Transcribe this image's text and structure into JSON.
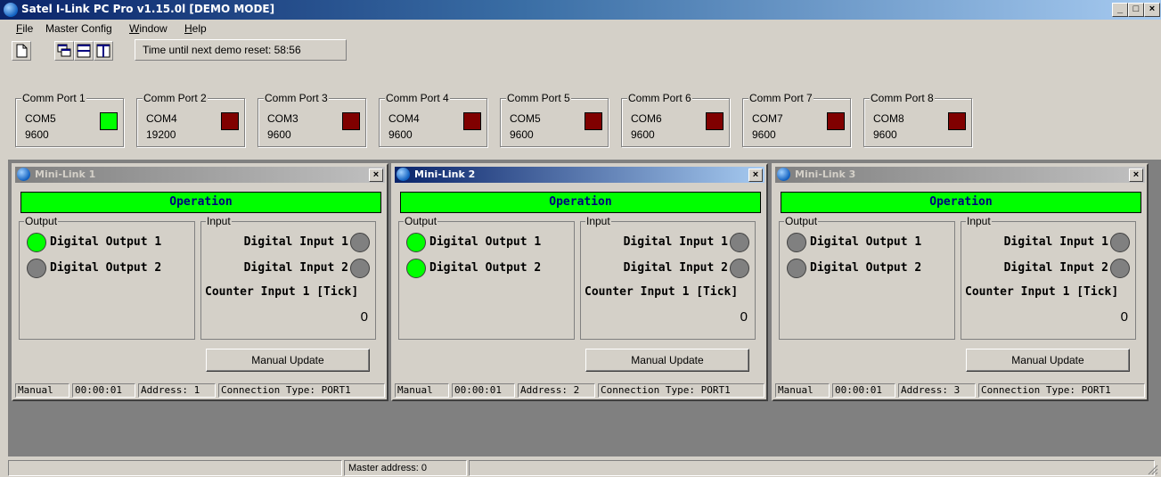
{
  "window": {
    "title": "Satel I-Link PC Pro v1.15.0l [DEMO MODE]"
  },
  "menu": {
    "items": [
      {
        "accel": "F",
        "rest": "ile"
      },
      {
        "accel": "",
        "rest": "Master Config"
      },
      {
        "accel": "W",
        "rest": "indow"
      },
      {
        "accel": "H",
        "rest": "elp"
      }
    ]
  },
  "toolbar": {
    "demo_text": "Time until next demo reset: 58:56"
  },
  "comm_ports": [
    {
      "label": "Comm Port 1",
      "port": "COM5",
      "baud": "9600",
      "status": "active",
      "color": "#00ff00"
    },
    {
      "label": "Comm Port 2",
      "port": "COM4",
      "baud": "19200",
      "status": "inactive",
      "color": "#800000"
    },
    {
      "label": "Comm Port 3",
      "port": "COM3",
      "baud": "9600",
      "status": "inactive",
      "color": "#800000"
    },
    {
      "label": "Comm Port 4",
      "port": "COM4",
      "baud": "9600",
      "status": "inactive",
      "color": "#800000"
    },
    {
      "label": "Comm Port 5",
      "port": "COM5",
      "baud": "9600",
      "status": "inactive",
      "color": "#800000"
    },
    {
      "label": "Comm Port 6",
      "port": "COM6",
      "baud": "9600",
      "status": "inactive",
      "color": "#800000"
    },
    {
      "label": "Comm Port 7",
      "port": "COM7",
      "baud": "9600",
      "status": "inactive",
      "color": "#800000"
    },
    {
      "label": "Comm Port 8",
      "port": "COM8",
      "baud": "9600",
      "status": "inactive",
      "color": "#800000"
    }
  ],
  "minilinks": [
    {
      "title": "Mini-Link 1",
      "active": false,
      "operation": "Operation",
      "output_label": "Output",
      "input_label": "Input",
      "outputs": [
        {
          "label": "Digital Output 1",
          "on": true
        },
        {
          "label": "Digital Output 2",
          "on": false
        }
      ],
      "inputs": [
        {
          "label": "Digital Input 1",
          "on": false
        },
        {
          "label": "Digital Input 2",
          "on": false
        }
      ],
      "counter_label": "Counter Input 1 [Tick]",
      "counter_value": "0",
      "update_label": "Manual Update",
      "status": {
        "mode": "Manual",
        "time": "00:00:01",
        "address": "Address: 1",
        "conn": "Connection Type: PORT1"
      }
    },
    {
      "title": "Mini-Link 2",
      "active": true,
      "operation": "Operation",
      "output_label": "Output",
      "input_label": "Input",
      "outputs": [
        {
          "label": "Digital Output 1",
          "on": true
        },
        {
          "label": "Digital Output 2",
          "on": true
        }
      ],
      "inputs": [
        {
          "label": "Digital Input 1",
          "on": false
        },
        {
          "label": "Digital Input 2",
          "on": false
        }
      ],
      "counter_label": "Counter Input 1 [Tick]",
      "counter_value": "0",
      "update_label": "Manual Update",
      "status": {
        "mode": "Manual",
        "time": "00:00:01",
        "address": "Address: 2",
        "conn": "Connection Type: PORT1"
      }
    },
    {
      "title": "Mini-Link 3",
      "active": false,
      "operation": "Operation",
      "output_label": "Output",
      "input_label": "Input",
      "outputs": [
        {
          "label": "Digital Output 1",
          "on": false
        },
        {
          "label": "Digital Output 2",
          "on": false
        }
      ],
      "inputs": [
        {
          "label": "Digital Input 1",
          "on": false
        },
        {
          "label": "Digital Input 2",
          "on": false
        }
      ],
      "counter_label": "Counter Input 1 [Tick]",
      "counter_value": "0",
      "update_label": "Manual Update",
      "status": {
        "mode": "Manual",
        "time": "00:00:01",
        "address": "Address: 3",
        "conn": "Connection Type: PORT1"
      }
    }
  ],
  "statusbar": {
    "master_address": "Master address: 0"
  }
}
